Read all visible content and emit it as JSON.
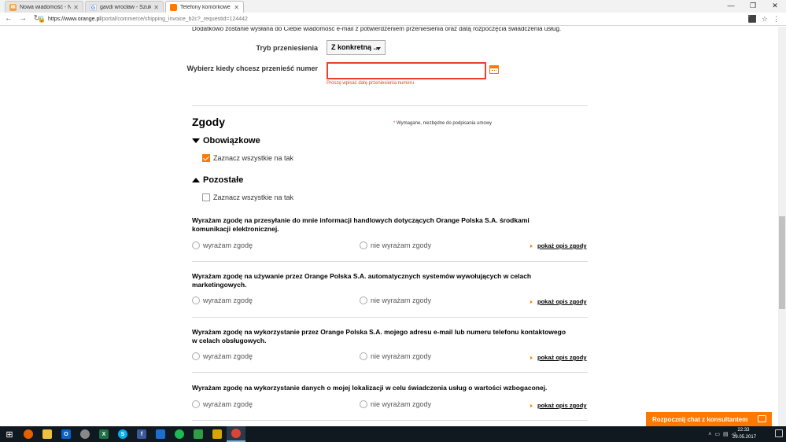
{
  "browser": {
    "tabs": [
      {
        "title": "Nowa wiadomość - Nasz",
        "icon": "mail-tab-icon",
        "color": "#f0a24b"
      },
      {
        "title": "gavdi wrocław - Szukaj w",
        "icon": "google-tab-icon",
        "color": "#4285f4"
      },
      {
        "title": "Telefony komórkowe Ora",
        "icon": "orange-tab-icon",
        "color": "#ff7900"
      }
    ],
    "url_prefix": "https://www.orange.pl",
    "url_rest": "/portal/commerce/shipping_invoice_b2c?_requestid=124442"
  },
  "intro_text": "Dodatkowo zostanie wysłana do Ciebie wiadomość e-mail z potwierdzeniem przeniesienia oraz datą rozpoczęcia świadczenia usług.",
  "transfer": {
    "mode_label": "Tryb przeniesienia",
    "mode_value": "Z konkretną ...",
    "date_label": "Wybierz kiedy chcesz przenieść numer",
    "date_value": "",
    "date_error": "Proszę wpisać datę przeniesienia numeru"
  },
  "consents": {
    "heading": "Zgody",
    "required_note_star": "*",
    "required_note": " Wymagane, niezbędne do podpisania umowy",
    "mandatory_heading": "Obowiązkowe",
    "mandatory_check_label": "Zaznacz wszystkie na tak",
    "mandatory_checked": true,
    "other_heading": "Pozostałe",
    "other_check_label": "Zaznacz wszystkie na tak",
    "other_checked": false,
    "yes_label": "wyrażam zgodę",
    "no_label": "nie wyrażam zgody",
    "show_desc_label": "pokaż opis zgody",
    "items": [
      {
        "text": "Wyrażam zgodę na przesyłanie do mnie informacji handlowych dotyczących Orange Polska S.A. środkami komunikacji elektronicznej."
      },
      {
        "text": "Wyrażam zgodę na używanie przez Orange Polska S.A. automatycznych systemów wywołujących w celach marketingowych."
      },
      {
        "text": "Wyrażam zgodę na wykorzystanie przez Orange Polska S.A. mojego adresu e-mail lub numeru telefonu kontaktowego w celach obsługowych."
      },
      {
        "text": "Wyrażam zgodę na wykorzystanie danych o mojej lokalizacji w celu świadczenia usług o wartości wzbogaconej."
      }
    ]
  },
  "chat_button": "Rozpocznij chat z konsultantem",
  "taskbar": {
    "time": "22:33",
    "date": "29.05.2017"
  },
  "colors": {
    "accent": "#ff7900",
    "error": "#e8412c"
  }
}
